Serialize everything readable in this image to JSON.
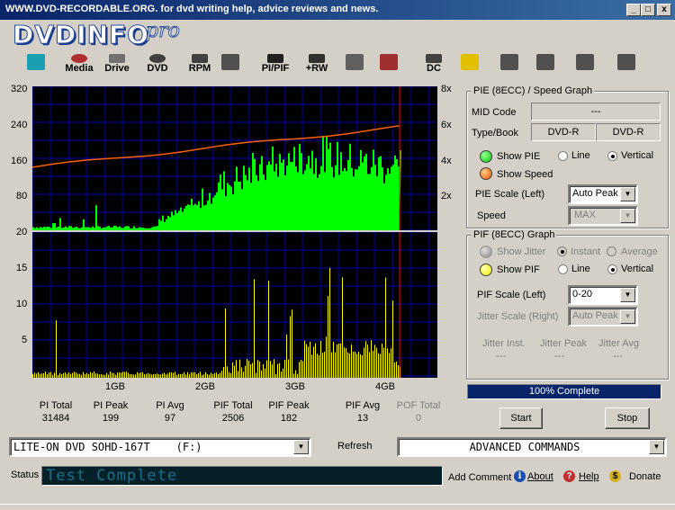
{
  "window": {
    "title": "WWW.DVD-RECORDABLE.ORG.  for dvd writing help, advice reviews and news.",
    "min": "_",
    "max": "□",
    "close": "x"
  },
  "logo": {
    "main": "DVDINFO",
    "pro": "pro"
  },
  "toolbar": [
    {
      "name": "monitor",
      "label": ""
    },
    {
      "name": "media",
      "label": "Media"
    },
    {
      "name": "drive",
      "label": "Drive"
    },
    {
      "name": "dvd",
      "label": "DVD"
    },
    {
      "name": "rpm",
      "label": "RPM"
    },
    {
      "name": "scan",
      "label": ""
    },
    {
      "name": "pipif",
      "label": "PI/PIF"
    },
    {
      "name": "rw",
      "label": "+RW"
    },
    {
      "name": "disc-tool",
      "label": ""
    },
    {
      "name": "disc-edit",
      "label": ""
    },
    {
      "name": "dc",
      "label": "DC"
    },
    {
      "name": "clipboard",
      "label": ""
    },
    {
      "name": "camera",
      "label": ""
    },
    {
      "name": "notes",
      "label": ""
    },
    {
      "name": "pause",
      "label": ""
    },
    {
      "name": "stop",
      "label": ""
    }
  ],
  "graph": {
    "top_y_ticks": [
      "320",
      "240",
      "160",
      "80",
      "20"
    ],
    "right_ticks": [
      "8x",
      "6x",
      "4x",
      "2x"
    ],
    "bottom_y_ticks": [
      "15",
      "10",
      "5"
    ],
    "x_ticks": [
      "1GB",
      "2GB",
      "3GB",
      "4GB"
    ],
    "colors": {
      "pi": "#00ff00",
      "pif": "#ffff00",
      "speed": "#ff6000",
      "grid": "#0000b0",
      "end": "#ff0000"
    }
  },
  "stats": [
    {
      "label": "PI Total",
      "value": "31484",
      "disabled": false
    },
    {
      "label": "PI Peak",
      "value": "199",
      "disabled": false
    },
    {
      "label": "PI Avg",
      "value": "97",
      "disabled": false
    },
    {
      "label": "PIF Total",
      "value": "2506",
      "disabled": false
    },
    {
      "label": "PIF Peak",
      "value": "182",
      "disabled": false
    },
    {
      "label": "PIF Avg",
      "value": "13",
      "disabled": false
    },
    {
      "label": "POF Total",
      "value": "0",
      "disabled": true
    }
  ],
  "pie": {
    "title": "PIE (8ECC) / Speed Graph",
    "mid_label": "MID Code",
    "mid_value": "---",
    "type_label": "Type/Book",
    "type_value": "DVD-R",
    "book_value": "DVD-R",
    "show_pie": "Show PIE",
    "line": "Line",
    "vertical": "Vertical",
    "show_speed": "Show Speed",
    "scale_label": "PIE Scale (Left)",
    "scale_value": "Auto Peak",
    "speed_label": "Speed",
    "speed_value": "MAX"
  },
  "pif": {
    "title": "PIF (8ECC) Graph",
    "show_jitter": "Show Jitter",
    "instant": "Instant",
    "average": "Average",
    "show_pif": "Show PIF",
    "line": "Line",
    "vertical": "Vertical",
    "scale_label": "PIF Scale (Left)",
    "scale_value": "0-20",
    "jitter_label": "Jitter Scale (Right)",
    "jitter_value": "Auto Peak",
    "jitter_inst": "Jitter Inst.",
    "jitter_peak": "Jitter Peak",
    "jitter_avg": "Jitter Avg",
    "inst_value": "---",
    "peak_value": "---",
    "avg_value": "---"
  },
  "progress": {
    "text": "100% Complete",
    "fraction": 1.0
  },
  "buttons": {
    "start": "Start",
    "stop": "Stop",
    "refresh": "Refresh"
  },
  "drive_select": "LITE-ON DVD SOHD-167T    (F:)",
  "commands_select": "ADVANCED COMMANDS",
  "status": {
    "label": "Status",
    "text": "Test Complete"
  },
  "footer": {
    "add_comment": "Add Comment",
    "about": "About",
    "help": "Help",
    "donate": "Donate"
  }
}
